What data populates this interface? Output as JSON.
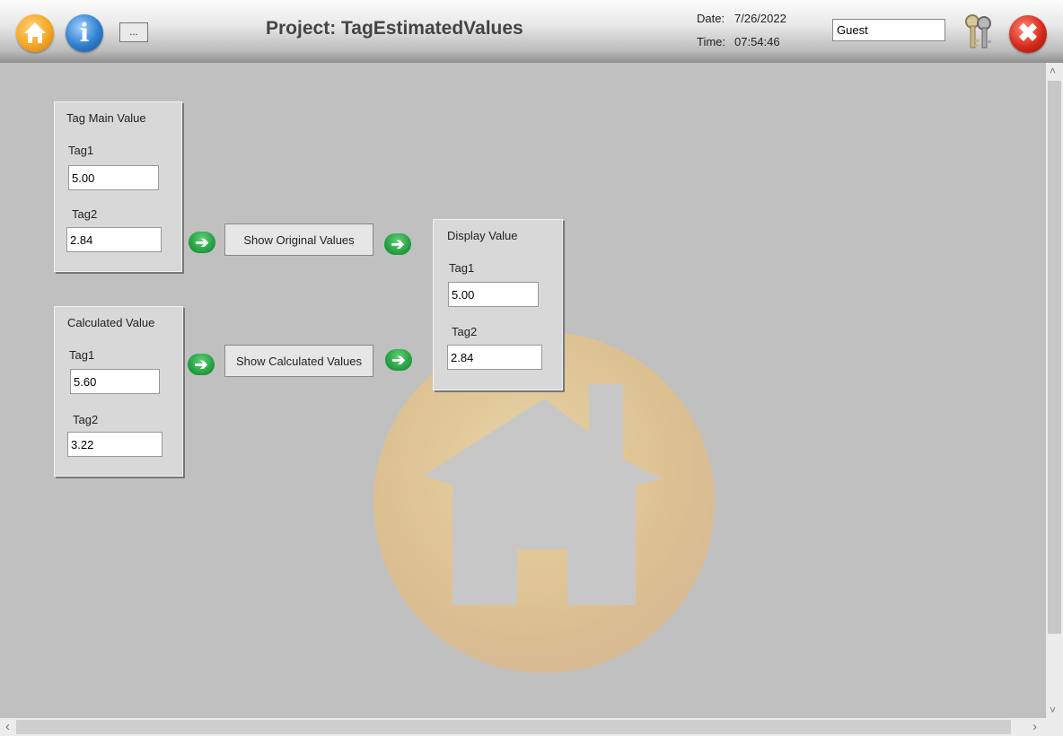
{
  "header": {
    "title": "Project: TagEstimatedValues",
    "date_label": "Date:",
    "date_value": "7/26/2022",
    "time_label": "Time:",
    "time_value": "07:54:46",
    "user": "Guest",
    "dots_label": "...",
    "info_glyph": "i",
    "close_glyph": "✖",
    "icons": [
      "home-icon",
      "info-icon",
      "keys-icon",
      "close-icon"
    ]
  },
  "main_panel": {
    "title": "Tag Main Value",
    "tag1_label": "Tag1",
    "tag1_value": "5.00",
    "tag2_label": "Tag2",
    "tag2_value": "2.84"
  },
  "calc_panel": {
    "title": "Calculated Value",
    "tag1_label": "Tag1",
    "tag1_value": "5.60",
    "tag2_label": "Tag2",
    "tag2_value": "3.22"
  },
  "display_panel": {
    "title": "Display Value",
    "tag1_label": "Tag1",
    "tag1_value": "5.00",
    "tag2_label": "Tag2",
    "tag2_value": "2.84"
  },
  "buttons": {
    "show_original": "Show Original Values",
    "show_calculated": "Show Calculated Values"
  },
  "arrow_glyph": "➔",
  "scroll": {
    "left": "‹",
    "right": "›",
    "up": "˄",
    "down": "˅"
  }
}
